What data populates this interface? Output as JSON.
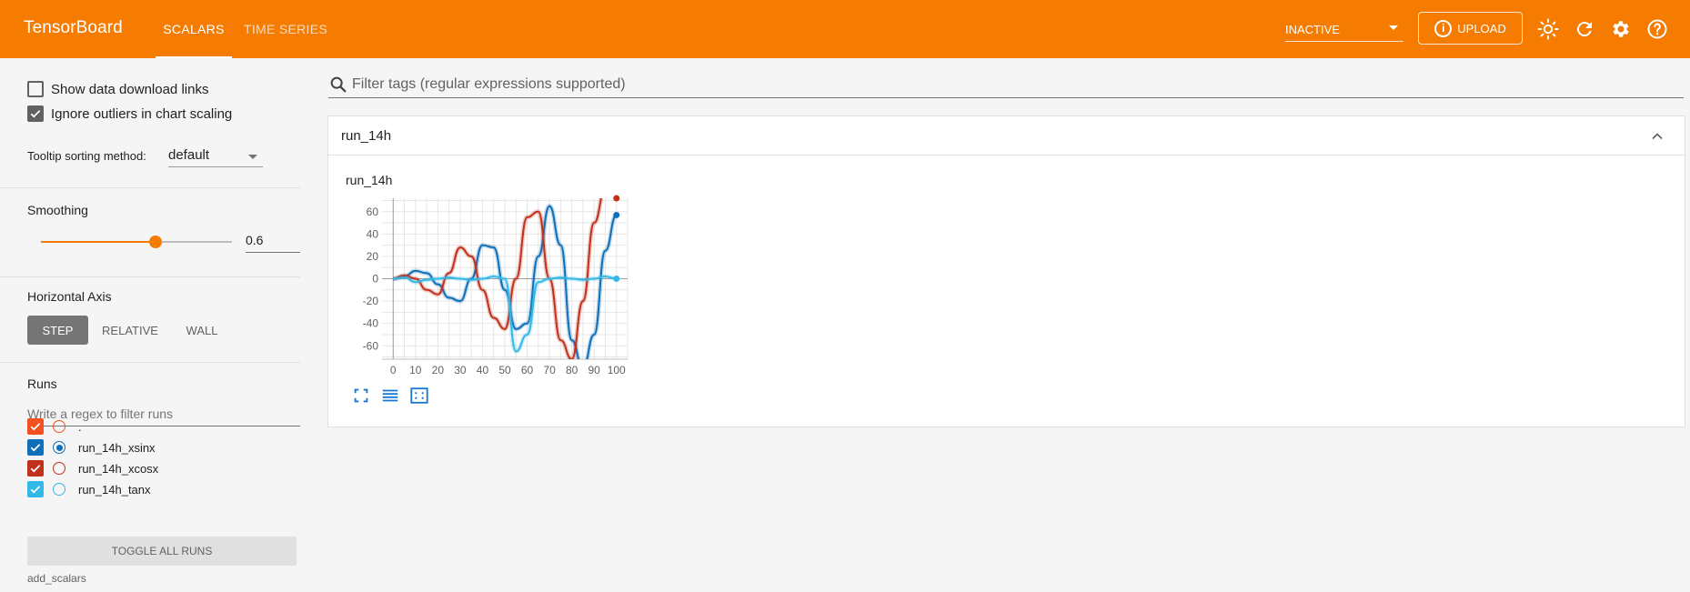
{
  "app": {
    "title": "TensorBoard",
    "tabs": [
      {
        "label": "SCALARS"
      },
      {
        "label": "TIME SERIES"
      }
    ],
    "reload_status": "INACTIVE",
    "upload_label": "UPLOAD",
    "icons": [
      "brightness-icon",
      "refresh-icon",
      "settings-icon",
      "help-icon"
    ]
  },
  "sidebar": {
    "show_download_links": {
      "label": "Show data download links",
      "checked": false
    },
    "ignore_outliers": {
      "label": "Ignore outliers in chart scaling",
      "checked": true
    },
    "tooltip_sorting": {
      "label": "Tooltip sorting method:",
      "value": "default"
    },
    "smoothing": {
      "label": "Smoothing",
      "value": "0.6",
      "level": 0.6
    },
    "horizontal_axis": {
      "label": "Horizontal Axis",
      "options": [
        "STEP",
        "RELATIVE",
        "WALL"
      ],
      "selected": "STEP"
    },
    "runs": {
      "label": "Runs",
      "filter_placeholder": "Write a regex to filter runs",
      "items": [
        {
          "name": ".",
          "color": "#f4511e",
          "checked": true,
          "selected": false
        },
        {
          "name": "run_14h_xsinx",
          "color": "#0f6fb8",
          "checked": true,
          "selected": true
        },
        {
          "name": "run_14h_xcosx",
          "color": "#c1311c",
          "checked": true,
          "selected": false
        },
        {
          "name": "run_14h_tanx",
          "color": "#33b9e8",
          "checked": true,
          "selected": false
        }
      ],
      "toggle_all_label": "TOGGLE ALL RUNS",
      "footer": "add_scalars"
    }
  },
  "main": {
    "tag_filter_placeholder": "Filter tags (regular expressions supported)",
    "card": {
      "title": "run_14h",
      "chart_title": "run_14h"
    }
  },
  "chart_data": {
    "type": "line",
    "title": "run_14h",
    "xlabel": "",
    "ylabel": "",
    "xlim": [
      -5,
      105
    ],
    "ylim": [
      -72,
      72
    ],
    "x_ticks": [
      0,
      10,
      20,
      30,
      40,
      50,
      60,
      70,
      80,
      90,
      100
    ],
    "y_ticks": [
      60,
      40,
      20,
      0,
      -20,
      -40,
      -60
    ],
    "grid": true,
    "legend": "none",
    "series": [
      {
        "name": "run_14h_xsinx",
        "color": "#0f6fb8",
        "x": [
          0,
          5,
          10,
          15,
          20,
          25,
          30,
          35,
          40,
          45,
          50,
          55,
          60,
          65,
          70,
          75,
          80,
          85,
          90,
          95,
          100
        ],
        "y": [
          0,
          2,
          7,
          5,
          -5,
          -17,
          -20,
          0,
          30,
          28,
          -10,
          -45,
          -40,
          20,
          65,
          30,
          -55,
          -80,
          -50,
          25,
          57
        ]
      },
      {
        "name": "run_14h_xcosx",
        "color": "#c1311c",
        "x": [
          0,
          5,
          10,
          15,
          20,
          25,
          30,
          35,
          40,
          45,
          50,
          55,
          60,
          65,
          70,
          75,
          80,
          85,
          90,
          95,
          100
        ],
        "y": [
          0,
          3,
          0,
          -10,
          -14,
          5,
          28,
          20,
          -10,
          -35,
          -45,
          0,
          55,
          60,
          0,
          -55,
          -72,
          -20,
          50,
          80,
          80
        ]
      },
      {
        "name": "run_14h_tanx",
        "color": "#33b9e8",
        "x": [
          0,
          5,
          10,
          15,
          20,
          25,
          30,
          35,
          40,
          45,
          50,
          55,
          60,
          65,
          70,
          75,
          80,
          85,
          90,
          95,
          100
        ],
        "y": [
          0,
          1,
          -3,
          -1,
          0,
          1,
          0,
          -1,
          0,
          2,
          0,
          -65,
          -50,
          -3,
          0,
          1,
          0,
          -1,
          0,
          2,
          0
        ]
      }
    ]
  }
}
